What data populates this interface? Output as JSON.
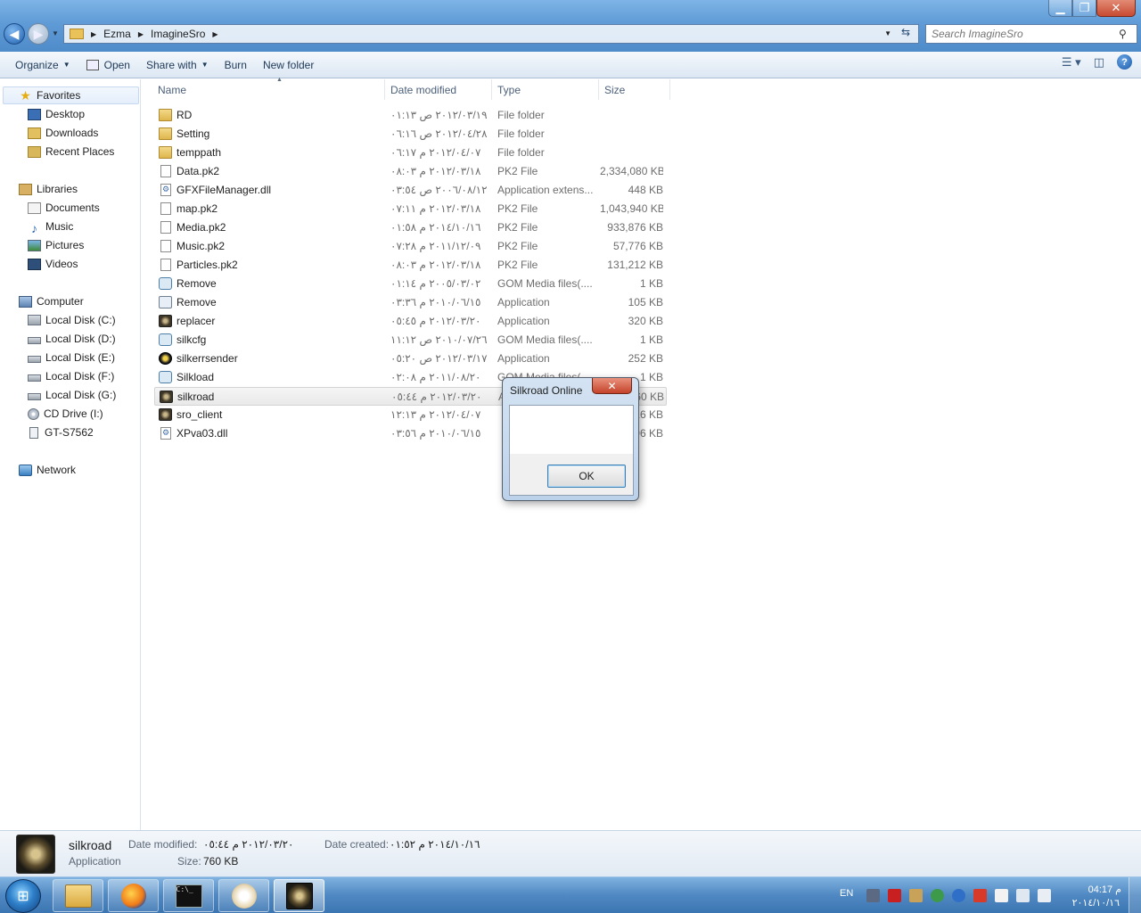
{
  "window": {
    "breadcrumb": [
      "Ezma",
      "ImagineSro"
    ],
    "search_placeholder": "Search ImagineSro"
  },
  "toolbar": {
    "organize": "Organize",
    "open": "Open",
    "share_with": "Share with",
    "burn": "Burn",
    "new_folder": "New folder"
  },
  "nav": {
    "favorites": "Favorites",
    "desktop": "Desktop",
    "downloads": "Downloads",
    "recent_places": "Recent Places",
    "libraries": "Libraries",
    "documents": "Documents",
    "music": "Music",
    "pictures": "Pictures",
    "videos": "Videos",
    "computer": "Computer",
    "disk_c": "Local Disk (C:)",
    "disk_d": "Local Disk (D:)",
    "disk_e": "Local Disk (E:)",
    "disk_f": "Local Disk (F:)",
    "disk_g": "Local Disk (G:)",
    "cd_drive": "CD Drive (I:)",
    "phone": "GT-S7562",
    "network": "Network"
  },
  "columns": {
    "name": "Name",
    "date": "Date modified",
    "type": "Type",
    "size": "Size"
  },
  "files": [
    {
      "name": "RD",
      "date": "٢٠١٢/٠٣/١٩ ص ٠١:١٣",
      "type": "File folder",
      "size": "",
      "icon": "folder-icon"
    },
    {
      "name": "Setting",
      "date": "٢٠١٢/٠٤/٢٨ ص ٠٦:١٦",
      "type": "File folder",
      "size": "",
      "icon": "folder-icon"
    },
    {
      "name": "temppath",
      "date": "٢٠١٢/٠٤/٠٧ م ٠٦:١٧",
      "type": "File folder",
      "size": "",
      "icon": "folder-icon"
    },
    {
      "name": "Data.pk2",
      "date": "٢٠١٢/٠٣/١٨ م ٠٨:٠٣",
      "type": "PK2 File",
      "size": "2,334,080 KB",
      "icon": "file-icon"
    },
    {
      "name": "GFXFileManager.dll",
      "date": "٢٠٠٦/٠٨/١٢ ص ٠٣:٥٤",
      "type": "Application extens...",
      "size": "448 KB",
      "icon": "dll-icon"
    },
    {
      "name": "map.pk2",
      "date": "٢٠١٢/٠٣/١٨ م ٠٧:١١",
      "type": "PK2 File",
      "size": "1,043,940 KB",
      "icon": "file-icon"
    },
    {
      "name": "Media.pk2",
      "date": "٢٠١٤/١٠/١٦ م ٠١:٥٨",
      "type": "PK2 File",
      "size": "933,876 KB",
      "icon": "file-icon"
    },
    {
      "name": "Music.pk2",
      "date": "٢٠١١/١٢/٠٩ م ٠٧:٢٨",
      "type": "PK2 File",
      "size": "57,776 KB",
      "icon": "file-icon"
    },
    {
      "name": "Particles.pk2",
      "date": "٢٠١٢/٠٣/١٨ م ٠٨:٠٣",
      "type": "PK2 File",
      "size": "131,212 KB",
      "icon": "file-icon"
    },
    {
      "name": "Remove",
      "date": "٢٠٠٥/٠٣/٠٢ م ٠١:١٤",
      "type": "GOM Media files(....",
      "size": "1 KB",
      "icon": "gom-icon"
    },
    {
      "name": "Remove",
      "date": "٢٠١٠/٠٦/١٥ م ٠٣:٣٦",
      "type": "Application",
      "size": "105 KB",
      "icon": "gear-app-icon"
    },
    {
      "name": "replacer",
      "date": "٢٠١٢/٠٣/٢٠ م ٠٥:٤٥",
      "type": "Application",
      "size": "320 KB",
      "icon": "silkroad-app-icon"
    },
    {
      "name": "silkcfg",
      "date": "٢٠١٠/٠٧/٢٦ ص ١١:١٢",
      "type": "GOM Media files(....",
      "size": "1 KB",
      "icon": "gom-icon"
    },
    {
      "name": "silkerrsender",
      "date": "٢٠١٢/٠٣/١٧ ص ٠٥:٢٠",
      "type": "Application",
      "size": "252 KB",
      "icon": "error-sender-icon"
    },
    {
      "name": "Silkload",
      "date": "٢٠١١/٠٨/٢٠ م ٠٢:٠٨",
      "type": "GOM Media files(....",
      "size": "1 KB",
      "icon": "gom-icon"
    },
    {
      "name": "silkroad",
      "date": "٢٠١٢/٠٣/٢٠ م ٠٥:٤٤",
      "type": "A",
      "size": "60 KB",
      "icon": "silkroad-app-icon"
    },
    {
      "name": "sro_client",
      "date": "٢٠١٢/٠٤/٠٧ م ١٢:١٣",
      "type": "",
      "size": "16 KB",
      "icon": "silkroad-app-icon"
    },
    {
      "name": "XPva03.dll",
      "date": "٢٠١٠/٠٦/١٥ م ٠٣:٥٦",
      "type": "",
      "size": "96 KB",
      "icon": "dll-icon"
    }
  ],
  "dialog": {
    "title": "Silkroad Online",
    "close": "✕",
    "message": "",
    "ok": "OK"
  },
  "details": {
    "name": "silkroad",
    "type": "Application",
    "date_modified_label": "Date modified:",
    "date_modified": "٢٠١٢/٠٣/٢٠ م ٠٥:٤٤",
    "date_created_label": "Date created:",
    "date_created": "٢٠١٤/١٠/١٦ م ٠١:٥٢",
    "size_label": "Size:",
    "size": "760 KB"
  },
  "taskbar": {
    "start": "⊞",
    "cmd_text": "C:\\_",
    "lang": "EN",
    "time": "م 04:17",
    "date": "٢٠١٤/١٠/١٦"
  }
}
